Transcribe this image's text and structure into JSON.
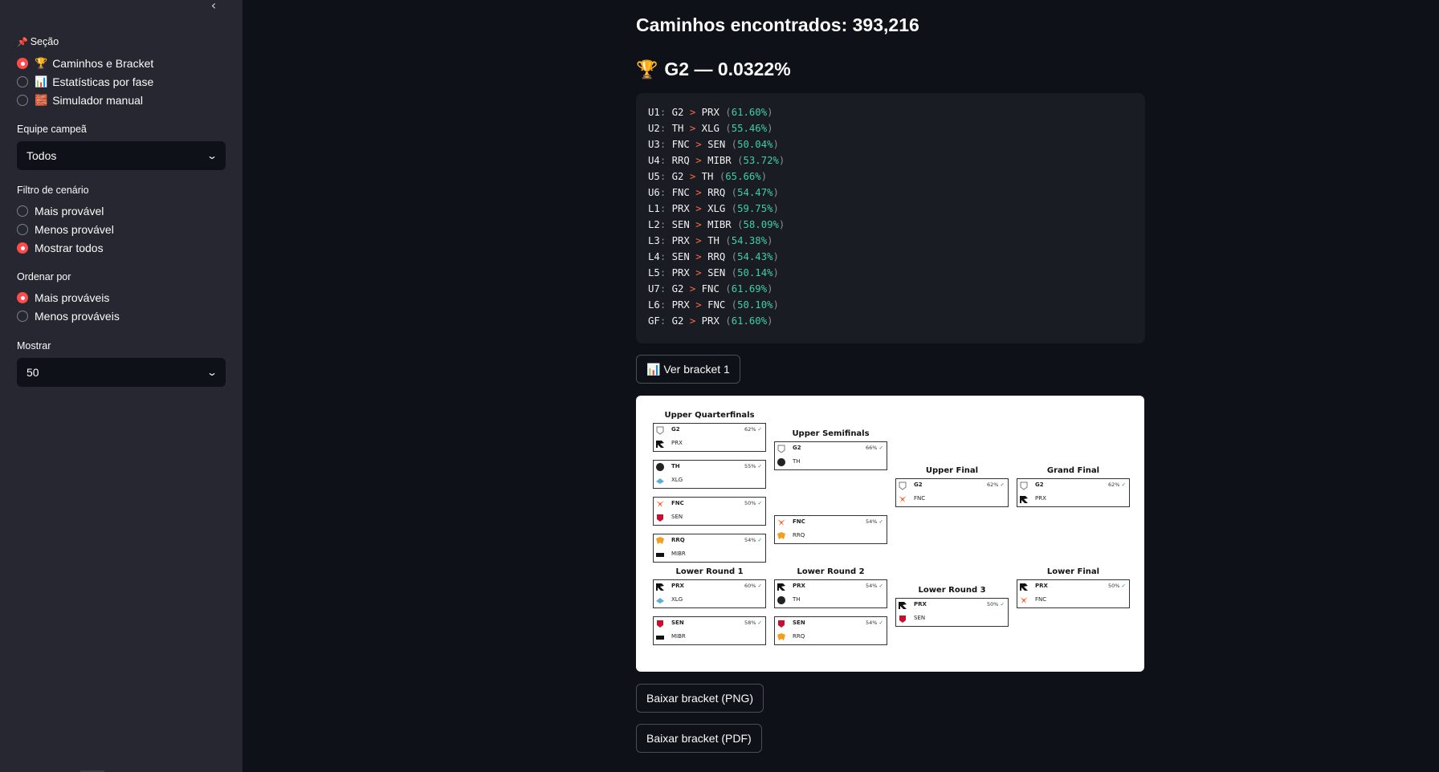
{
  "sidebar": {
    "collapse_glyph": "‹",
    "section_label": "Seção",
    "section_icon": "📌",
    "sections": [
      {
        "label": "Caminhos e Bracket",
        "icon": "🏆",
        "selected": true
      },
      {
        "label": "Estatísticas por fase",
        "icon": "📊",
        "selected": false
      },
      {
        "label": "Simulador manual",
        "icon": "🧱",
        "selected": false
      }
    ],
    "champion_label": "Equipe campeã",
    "champion_value": "Todos",
    "scenario_label": "Filtro de cenário",
    "scenarios": [
      {
        "label": "Mais provável",
        "selected": false
      },
      {
        "label": "Menos provável",
        "selected": false
      },
      {
        "label": "Mostrar todos",
        "selected": true
      }
    ],
    "order_label": "Ordenar por",
    "orders": [
      {
        "label": "Mais prováveis",
        "selected": true
      },
      {
        "label": "Menos prováveis",
        "selected": false
      }
    ],
    "show_label": "Mostrar",
    "show_value": "50"
  },
  "main": {
    "paths_title": "Caminhos encontrados: 393,216",
    "path_icon": "🏆",
    "path_title": "G2 — 0.0322%",
    "path_lines": [
      {
        "m": "U1",
        "w": "G2",
        "l": "PRX",
        "p": "61.60%"
      },
      {
        "m": "U2",
        "w": "TH",
        "l": "XLG",
        "p": "55.46%"
      },
      {
        "m": "U3",
        "w": "FNC",
        "l": "SEN",
        "p": "50.04%"
      },
      {
        "m": "U4",
        "w": "RRQ",
        "l": "MIBR",
        "p": "53.72%"
      },
      {
        "m": "U5",
        "w": "G2",
        "l": "TH",
        "p": "65.66%"
      },
      {
        "m": "U6",
        "w": "FNC",
        "l": "RRQ",
        "p": "54.47%"
      },
      {
        "m": "L1",
        "w": "PRX",
        "l": "XLG",
        "p": "59.75%"
      },
      {
        "m": "L2",
        "w": "SEN",
        "l": "MIBR",
        "p": "58.09%"
      },
      {
        "m": "L3",
        "w": "PRX",
        "l": "TH",
        "p": "54.38%"
      },
      {
        "m": "L4",
        "w": "SEN",
        "l": "RRQ",
        "p": "54.43%"
      },
      {
        "m": "L5",
        "w": "PRX",
        "l": "SEN",
        "p": "50.14%"
      },
      {
        "m": "U7",
        "w": "G2",
        "l": "FNC",
        "p": "61.69%"
      },
      {
        "m": "L6",
        "w": "PRX",
        "l": "FNC",
        "p": "50.10%"
      },
      {
        "m": "GF",
        "w": "G2",
        "l": "PRX",
        "p": "61.60%"
      }
    ],
    "view_bracket_label": "📊 Ver bracket 1",
    "download_png_label": "Baixar bracket (PNG)",
    "download_pdf_label": "Baixar bracket (PDF)"
  },
  "bracket": {
    "rounds": {
      "upper_qf": "Upper Quarterfinals",
      "upper_sf": "Upper Semifinals",
      "upper_final": "Upper Final",
      "grand_final": "Grand Final",
      "lower_r1": "Lower Round 1",
      "lower_r2": "Lower Round 2",
      "lower_r3": "Lower Round 3",
      "lower_final": "Lower Final"
    },
    "check_glyph": "✓",
    "matches": [
      {
        "id": "uqf1",
        "round": "upper_qf",
        "a": "G2",
        "b": "PRX",
        "pct": "62%"
      },
      {
        "id": "uqf2",
        "round": "upper_qf",
        "a": "TH",
        "b": "XLG",
        "pct": "55%"
      },
      {
        "id": "uqf3",
        "round": "upper_qf",
        "a": "FNC",
        "b": "SEN",
        "pct": "50%"
      },
      {
        "id": "uqf4",
        "round": "upper_qf",
        "a": "RRQ",
        "b": "MIBR",
        "pct": "54%"
      },
      {
        "id": "usf1",
        "round": "upper_sf",
        "a": "G2",
        "b": "TH",
        "pct": "66%"
      },
      {
        "id": "usf2",
        "round": "upper_sf",
        "a": "FNC",
        "b": "RRQ",
        "pct": "54%"
      },
      {
        "id": "uf",
        "round": "upper_final",
        "a": "G2",
        "b": "FNC",
        "pct": "62%"
      },
      {
        "id": "gf",
        "round": "grand_final",
        "a": "G2",
        "b": "PRX",
        "pct": "62%"
      },
      {
        "id": "lr1a",
        "round": "lower_r1",
        "a": "PRX",
        "b": "XLG",
        "pct": "60%"
      },
      {
        "id": "lr1b",
        "round": "lower_r1",
        "a": "SEN",
        "b": "MIBR",
        "pct": "58%"
      },
      {
        "id": "lr2a",
        "round": "lower_r2",
        "a": "PRX",
        "b": "TH",
        "pct": "54%"
      },
      {
        "id": "lr2b",
        "round": "lower_r2",
        "a": "SEN",
        "b": "RRQ",
        "pct": "54%"
      },
      {
        "id": "lr3",
        "round": "lower_r3",
        "a": "PRX",
        "b": "SEN",
        "pct": "50%"
      },
      {
        "id": "lf",
        "round": "lower_final",
        "a": "PRX",
        "b": "FNC",
        "pct": "50%"
      }
    ]
  }
}
